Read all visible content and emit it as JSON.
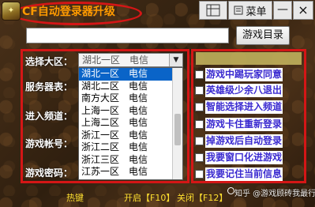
{
  "title": {
    "text": "CF自动登录器升级",
    "icon_name": "app-logo-icon"
  },
  "titlebar": {
    "menu_label": "菜单",
    "minimize_label": "—",
    "close_label": "×"
  },
  "top": {
    "directory_button": "游戏目录",
    "directory_value": ""
  },
  "labels": {
    "region": "选择大区：",
    "server": "服务器表：",
    "channel": "进入频道：",
    "account": "游戏帐号：",
    "password": "游戏密码："
  },
  "region_select": {
    "value": "湖北一区　电信"
  },
  "dropdown": {
    "items": [
      {
        "label": "湖北一区　电信",
        "selected": true
      },
      {
        "label": "湖北二区　电信",
        "selected": false
      },
      {
        "label": "南方大区　电信",
        "selected": false
      },
      {
        "label": "上海一区　电信",
        "selected": false
      },
      {
        "label": "上海二区　电信",
        "selected": false
      },
      {
        "label": "浙江一区　电信",
        "selected": false
      },
      {
        "label": "浙江二区　电信",
        "selected": false
      },
      {
        "label": "浙江三区　电信",
        "selected": false
      },
      {
        "label": "江苏一区　电信",
        "selected": false
      }
    ]
  },
  "options": [
    {
      "label": "游戏中踢玩家同意",
      "checked": false
    },
    {
      "label": "英雄级少余八退出",
      "checked": false
    },
    {
      "label": "智能选择进入频道",
      "checked": false
    },
    {
      "label": "游戏卡住重新登录",
      "checked": false
    },
    {
      "label": "掉游戏后自动登录",
      "checked": false
    },
    {
      "label": "我要窗口化进游戏",
      "checked": false
    },
    {
      "label": "我要记住当前信息",
      "checked": false
    }
  ],
  "footer": {
    "hotkey_label": "热键",
    "start_label": "开启【F10】",
    "close_label": "关闭【F12】",
    "watermark": "知乎 @游戏顾砖我最行"
  },
  "colors": {
    "frame_red": "#d41616",
    "title_orange": "#ff9a00",
    "option_blue": "#3a2ad0",
    "hotkey_yellow": "#ffe030",
    "selection_blue": "#0a64c8"
  }
}
